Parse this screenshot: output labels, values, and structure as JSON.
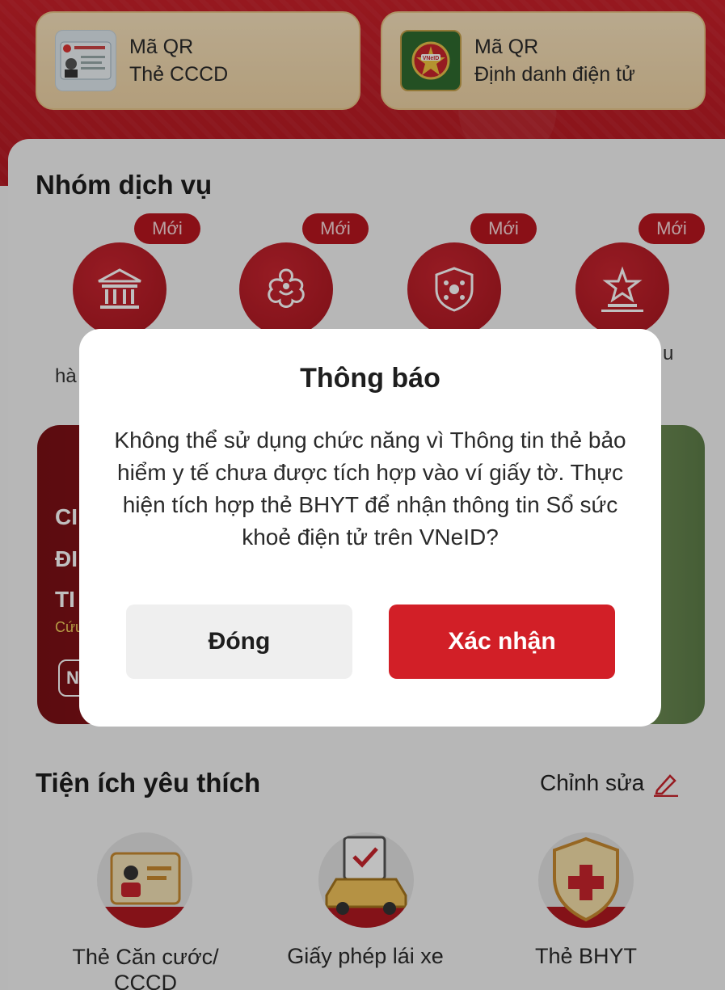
{
  "qr_cards": [
    {
      "line1": "Mã QR",
      "line2": "Thẻ CCCD",
      "icon": "id-card-icon"
    },
    {
      "line1": "Mã QR",
      "line2": "Định danh điện tử",
      "icon": "vneid-emblem-icon"
    }
  ],
  "services": {
    "title": "Nhóm dịch vụ",
    "badge": "Mới",
    "items": [
      {
        "icon": "bank-building-icon",
        "label_partial": "hà"
      },
      {
        "icon": "family-flower-icon",
        "label_partial": ""
      },
      {
        "icon": "health-shield-icon",
        "label_partial": ""
      },
      {
        "icon": "star-podium-icon",
        "label_partial": "u"
      }
    ]
  },
  "banner": {
    "lines": [
      "CI",
      "ĐI",
      "TI"
    ],
    "sub": "Cứu",
    "button": "N"
  },
  "favourites": {
    "title": "Tiện ích yêu thích",
    "edit_label": "Chỉnh sửa",
    "items": [
      {
        "label": "Thẻ Căn cước/\nCCCD",
        "icon": "id-card-icon"
      },
      {
        "label": "Giấy phép lái xe",
        "icon": "car-license-icon"
      },
      {
        "label": "Thẻ BHYT",
        "icon": "health-insurance-shield-icon"
      }
    ]
  },
  "modal": {
    "title": "Thông báo",
    "message": "Không thể sử dụng chức năng vì Thông tin thẻ bảo hiểm y tế chưa được tích hợp vào ví giấy tờ. Thực hiện tích hợp thẻ BHYT để nhận thông tin Sổ sức khoẻ điện tử trên VNeID?",
    "close_label": "Đóng",
    "confirm_label": "Xác nhận"
  },
  "colors": {
    "brand_red": "#d21f27",
    "header_red": "#c8202a",
    "card_gold": "#f2dbb1"
  }
}
